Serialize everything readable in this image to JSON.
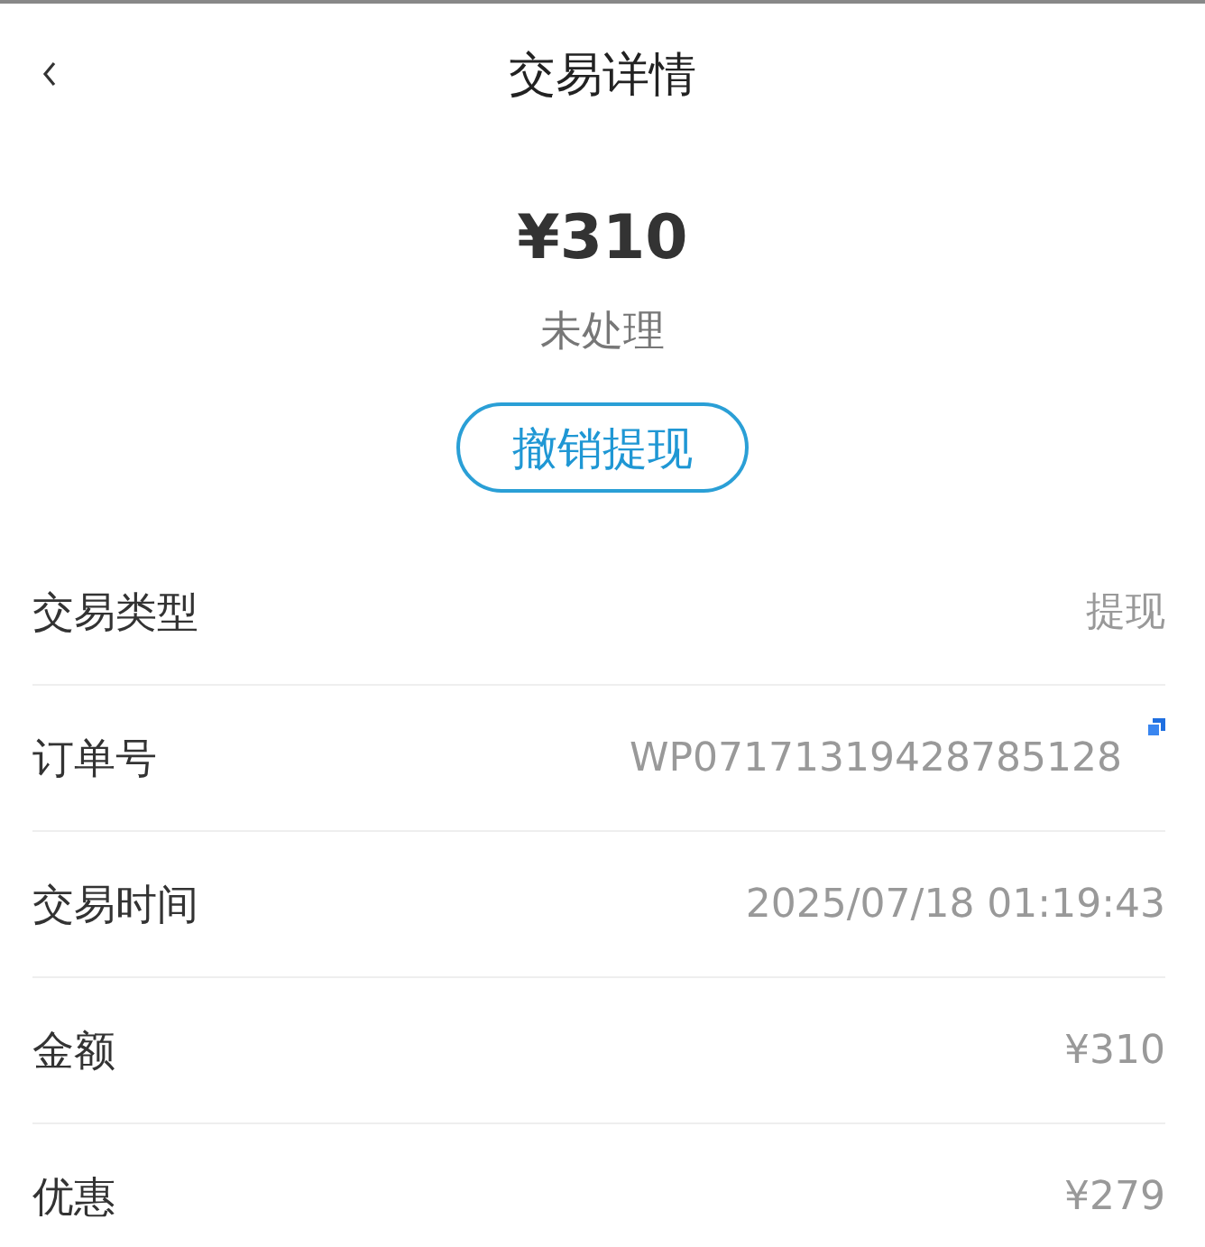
{
  "header": {
    "title": "交易详情"
  },
  "summary": {
    "amount": "¥310",
    "status": "未处理",
    "action": "撤销提现"
  },
  "rows": [
    {
      "label": "交易类型",
      "value": "提现",
      "copyable": false
    },
    {
      "label": "订单号",
      "value": "WP07171319428785128",
      "copyable": true
    },
    {
      "label": "交易时间",
      "value": "2025/07/18 01:19:43",
      "copyable": false
    },
    {
      "label": "金额",
      "value": "¥310",
      "copyable": false
    },
    {
      "label": "优惠",
      "value": "¥279",
      "copyable": false
    }
  ]
}
